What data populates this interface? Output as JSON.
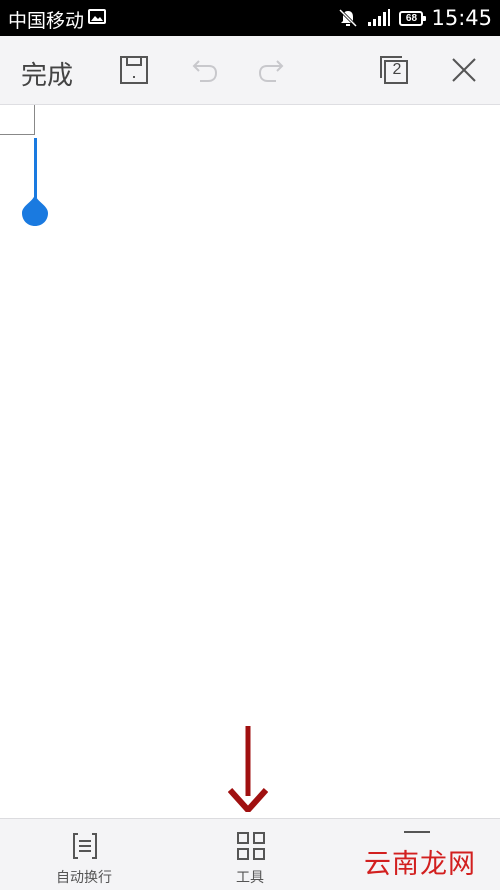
{
  "status_bar": {
    "carrier": "中国移动",
    "time": "15:45",
    "battery": "68",
    "icons": [
      "image-icon",
      "silent-icon",
      "signal-icon",
      "battery-icon"
    ]
  },
  "toolbar": {
    "done_label": "完成",
    "page_count": "2",
    "icons": [
      "save-icon",
      "undo-icon",
      "redo-icon",
      "pages-icon",
      "close-icon"
    ]
  },
  "bottom_bar": {
    "items": [
      {
        "label": "自动换行",
        "icon": "wrap-text-icon"
      },
      {
        "label": "工具",
        "icon": "tools-grid-icon"
      }
    ]
  },
  "annotation": {
    "arrow_color": "#a01010"
  },
  "watermark": "云南龙网",
  "colors": {
    "accent": "#1a7ae0",
    "toolbar_bg": "#f4f4f6"
  }
}
